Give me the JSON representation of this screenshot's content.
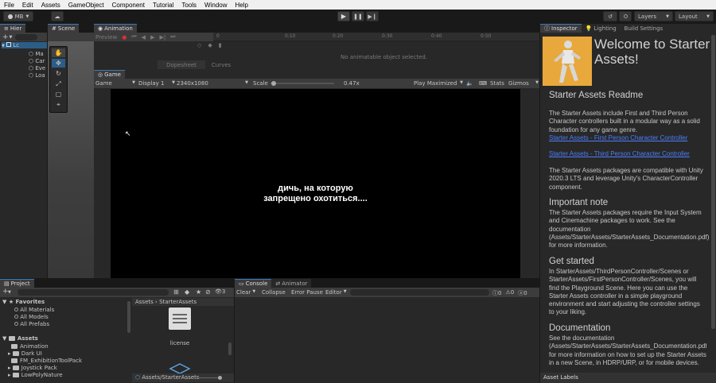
{
  "menu": [
    "File",
    "Edit",
    "Assets",
    "GameObject",
    "Component",
    "Tutorial",
    "Tools",
    "Window",
    "Help"
  ],
  "toolbar": {
    "account": "MB",
    "layers": "Layers",
    "layout": "Layout"
  },
  "hierarchy": {
    "tab": "Hier",
    "scene_item": "Lc",
    "items": [
      "Ma",
      "Car",
      "Eve",
      "Loa"
    ]
  },
  "scene": {
    "tab": "Scene"
  },
  "animation": {
    "tab": "Animation",
    "preview": "Preview",
    "ruler": [
      "0",
      "0:10",
      "0:20",
      "0:30",
      "0:40",
      "0:50"
    ],
    "no_clip": "No animatable object selected.",
    "dopesheet": "Dopesheet",
    "curves": "Curves"
  },
  "game": {
    "tab": "Game",
    "mode": "Game",
    "display": "Display 1",
    "resolution": "2340x1080",
    "scale_label": "Scale",
    "scale_value": "0.47x",
    "scale_fraction": 0.02,
    "play_mode": "Play Maximized",
    "stats": "Stats",
    "gizmos": "Gizmos",
    "subtitle_line1": "дичь, на которую",
    "subtitle_line2": "запрещено охотиться...."
  },
  "project": {
    "tab": "Project",
    "favorites": "Favorites",
    "fav_items": [
      "All Materials",
      "All Models",
      "All Prefabs"
    ],
    "assets": "Assets",
    "asset_items": [
      "Animation",
      "Dark UI",
      "FM_ExhibitionToolPack",
      "Joystick Pack",
      "LowPolyNature"
    ],
    "breadcrumb_root": "Assets",
    "breadcrumb_sep": "›",
    "breadcrumb_current": "StarterAssets",
    "file_name": "license",
    "path": "Assets/StarterAssets",
    "badge_count": "3"
  },
  "console": {
    "tab": "Console",
    "animator_tab": "Animator",
    "clear": "Clear",
    "collapse": "Collapse",
    "error_pause": "Error Pause",
    "editor": "Editor",
    "count_log": "0",
    "count_warn": "0",
    "count_err": "0"
  },
  "inspector": {
    "tabs": [
      "Inspector",
      "Lighting",
      "Build Settings"
    ],
    "title": "Welcome to Starter Assets!",
    "readme": "Starter Assets Readme",
    "intro": "The Starter Assets include First and Third Person Character controllers built in a modular way as a solid foundation for any game genre.",
    "link1": "Starter Assets - First Person Character Controller",
    "link2": "Starter Assets - Third Person Character Controller",
    "compat": "The Starter Assets packages are compatible with Unity 2020.3 LTS and leverage Unity's CharacterController component.",
    "important_h": "Important note",
    "important": "The Starter Assets packages require the Input System and Cinemachine packages to work. See the documentation (Assets/StarterAssets/StarterAssets_Documentation.pdf) for more information.",
    "started_h": "Get started",
    "started": "In StarterAssets/ThirdPersonController/Scenes or StarterAssets/FirstPersonController/Scenes, you will find the Playground Scene. Here you can use the Starter Assets controller in a simple playground environment and start adjusting the controller settings to your liking.",
    "doc_h": "Documentation",
    "doc": "See the documentation (Assets/StarterAssets/StarterAssets_Documentation.pdf) for more information on how to set up the Starter Assets in a new Scene, in HDRP/URP, or for mobile devices.",
    "asset_labels": "Asset Labels"
  },
  "colors": {
    "accent": "#3a79bb",
    "link": "#4c7eff",
    "thumb_bg": "#e8a83c"
  }
}
